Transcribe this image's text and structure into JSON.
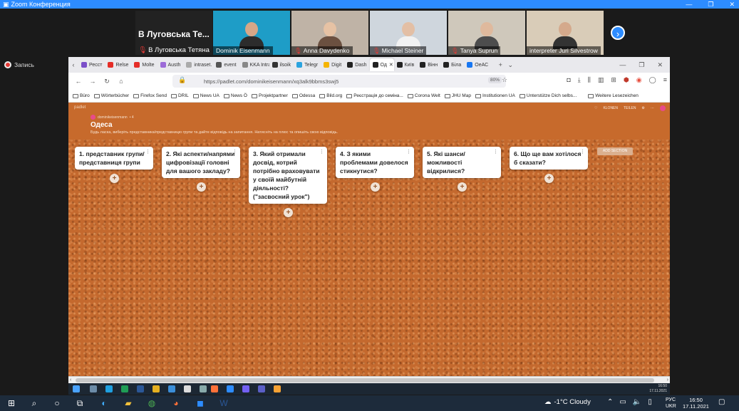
{
  "zoom": {
    "title": "Zoom Конференция",
    "recording_label": "Запись"
  },
  "participants": [
    {
      "name": "В Луговська Тетяна",
      "short": "В Луговська Те...",
      "muted": true,
      "video": false
    },
    {
      "name": "Dominik Eisenmann",
      "muted": false,
      "video": true
    },
    {
      "name": "Anna Davydenko",
      "muted": true,
      "video": true
    },
    {
      "name": "Michael Steiner",
      "muted": true,
      "video": true
    },
    {
      "name": "Tanya Suprun",
      "muted": true,
      "video": true
    },
    {
      "name": "interpreter Juri Silvestrow",
      "muted": false,
      "video": true
    }
  ],
  "browser": {
    "tabs": [
      {
        "label": "Ресст",
        "color": "#7b4fc9"
      },
      {
        "label": "Relse",
        "color": "#e52d27"
      },
      {
        "label": "Molte",
        "color": "#e52d27"
      },
      {
        "label": "Austh",
        "color": "#9c6bd8"
      },
      {
        "label": "intraset.",
        "color": "#aaa"
      },
      {
        "label": "event",
        "color": "#555"
      },
      {
        "label": "KKA Intra",
        "color": "#888"
      },
      {
        "label": "ilsoik",
        "color": "#333"
      },
      {
        "label": "Telegr",
        "color": "#2aa3df"
      },
      {
        "label": "Digit",
        "color": "#f5b400"
      },
      {
        "label": "Dash",
        "color": "#222"
      },
      {
        "label": "Од",
        "color": "#222",
        "active": true
      },
      {
        "label": "Київ",
        "color": "#222"
      },
      {
        "label": "Вінн",
        "color": "#222"
      },
      {
        "label": "Біла",
        "color": "#222"
      },
      {
        "label": "ОеАС",
        "color": "#1877f2"
      }
    ],
    "url": "https://padlet.com/dominikeisenmann/xq3alk9bbms3swj5",
    "zoom_level": "80%",
    "bookmarks": [
      "Büro",
      "Wörterbücher",
      "Firefox Send",
      "DRIL",
      "News UA",
      "News Ö",
      "Projektpartner",
      "Odessa",
      "Bild.org",
      "Реєстрація до семіна...",
      "Corona Welt",
      "JHU Map",
      "Institutionen UA",
      "Unterstütze Dich selbs...",
      "Weitere Lesezeichen"
    ]
  },
  "padlet": {
    "brand": "padlet",
    "author": "dominikeisenmann",
    "author_suffix": "• 4",
    "title": "Одеса",
    "description": "Будь ласка, виберіть представника/представницю групи та дайте відповідь на запитання. Натисніть на плюс та опишіть свою відповідь.",
    "actions": [
      "♡",
      "KLONEN",
      "TEILEN",
      "⚙",
      "⋯"
    ],
    "columns": [
      "1. представник групи/ представниця групи",
      "2. Які аспекти/напрями цифровізації головні для вашого закладу?",
      "3. Який отримали досвід, котрий потрібно враховувати у своїй майбутній діяльності? (\"засвосний урок\")",
      "4. З якими проблемами довелося стикнутися?",
      "5. Які шанси/можливості відкрилися?",
      "6. Що ще вам хотілося б сказати?"
    ],
    "add_section": "ADD SECTION"
  },
  "inner_clock": {
    "time": "16:50",
    "date": "17.11.2021"
  },
  "taskbar": {
    "weather": "-1°C Cloudy",
    "lang_top": "РУС",
    "lang_bottom": "UKR",
    "time": "16:50",
    "date": "17.11.2021"
  },
  "colors": {
    "zoom_blue": "#2d8cff",
    "padlet_orange": "#c76a2c"
  }
}
